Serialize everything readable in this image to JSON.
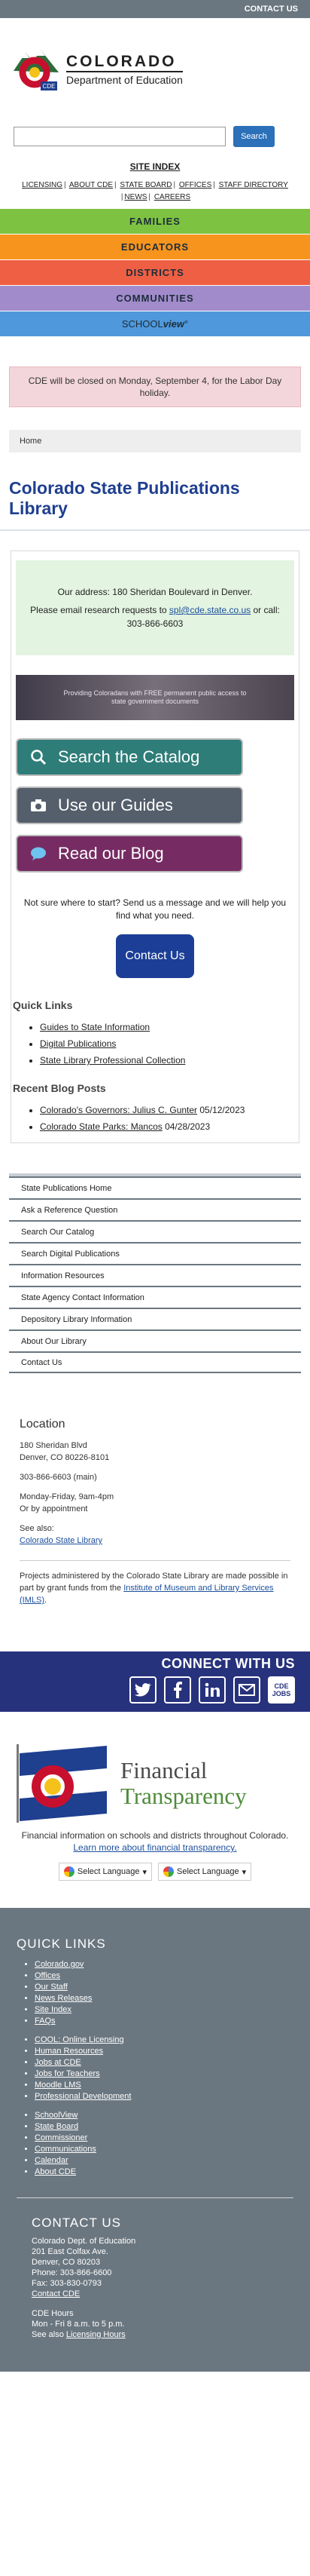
{
  "topbar": {
    "contact_us": "CONTACT US"
  },
  "brand": {
    "name": "COLORADO",
    "dept": "Department of Education",
    "logo_badge": "CDE"
  },
  "search": {
    "placeholder": "",
    "button": "Search"
  },
  "site_index": "SITE INDEX",
  "util_nav": [
    "LICENSING",
    "ABOUT CDE",
    "STATE BOARD",
    "OFFICES",
    "STAFF DIRECTORY",
    "NEWS",
    "CAREERS"
  ],
  "bands": {
    "families": "FAMILIES",
    "educators": "EDUCATORS",
    "districts": "DISTRICTS",
    "communities": "COMMUNITIES",
    "schoolview_a": "SCHOOL",
    "schoolview_b": "view"
  },
  "colors": {
    "families": "#7ec241",
    "educators": "#f7941e",
    "districts": "#ef5f43",
    "communities": "#a18bcb",
    "schoolview": "#4f98db",
    "title": "#1f3f8f",
    "connect": "#27327c"
  },
  "alert": "CDE will be closed on Monday, September 4, for the Labor Day holiday.",
  "breadcrumb": {
    "home": "Home"
  },
  "page_title": "Colorado State Publications Library",
  "address_box": {
    "line1": "Our address:  180 Sheridan Boulevard in Denver.",
    "line2_pre": "Please email research requests to ",
    "email": "spl@cde.state.co.us",
    "line2_post": " or call: 303-866-6603"
  },
  "banner_text": "Providing Coloradans with FREE permanent public access to state government documents",
  "buttons": {
    "catalog": "Search the Catalog",
    "guides": "Use our Guides",
    "blog": "Read our Blog"
  },
  "help_text": "Not sure where to start? Send us a message and we will help you find what you need.",
  "contact_button": "Contact Us",
  "quick_links": {
    "heading": "Quick Links",
    "items": [
      "Guides to State Information",
      "Digital Publications",
      "State Library Professional Collection"
    ]
  },
  "recent_posts": {
    "heading": "Recent Blog Posts",
    "items": [
      {
        "title": "Colorado's Governors: Julius C. Gunter",
        "date": " 05/12/2023"
      },
      {
        "title": "Colorado State Parks: Mancos",
        "date": " 04/28/2023"
      }
    ]
  },
  "side_nav": [
    "State Publications Home",
    "Ask a Reference Question",
    "Search Our Catalog",
    "Search Digital Publications",
    "Information Resources",
    "State Agency Contact Information",
    "Depository Library Information",
    "About Our Library",
    "Contact Us"
  ],
  "location": {
    "heading": "Location",
    "street": "180 Sheridan Blvd",
    "city": "Denver, CO 80226-8101",
    "phone": "303-866-6603 (main)",
    "hours1": "Monday-Friday, 9am-4pm",
    "hours2": "Or by appointment",
    "see_also": "See also:",
    "see_also_link": "Colorado State Library",
    "funding_pre": "Projects administered by the Colorado State Library are made possible in part by grant funds from the ",
    "funding_link": "Institute of Museum and Library Services (IMLS)",
    "funding_post": "."
  },
  "connect": {
    "title": "CONNECT WITH US",
    "jobs_badge": "CDE JOBS"
  },
  "financial": {
    "title1": "Financial",
    "title2": "Transparency",
    "text_pre": "Financial information on schools and districts throughout Colorado. ",
    "text_link": "Learn more about financial transparency."
  },
  "language": {
    "select": "Select Language"
  },
  "footer": {
    "quick_links_heading": "QUICK LINKS",
    "group1": [
      "Colorado.gov",
      "Offices",
      "Our Staff",
      "News Releases",
      "Site Index",
      "FAQs"
    ],
    "group2": [
      "COOL: Online Licensing",
      "Human Resources",
      "Jobs at CDE",
      "Jobs for Teachers",
      "Moodle LMS",
      "Professional Development"
    ],
    "group3": [
      "SchoolView",
      "State Board",
      "Commissioner",
      "Communications",
      "Calendar",
      "About CDE"
    ],
    "contact_heading": "CONTACT US",
    "org": "Colorado Dept. of Education",
    "street": "201 East Colfax Ave.",
    "city": "Denver, CO 80203",
    "phone": "Phone: 303-866-6600",
    "fax": "Fax: 303-830-0793",
    "contact_link": "Contact CDE",
    "hours_title": "CDE Hours",
    "hours": "Mon - Fri 8 a.m. to 5 p.m.",
    "see_also_pre": "See also ",
    "licensing_hours": "Licensing Hours"
  }
}
